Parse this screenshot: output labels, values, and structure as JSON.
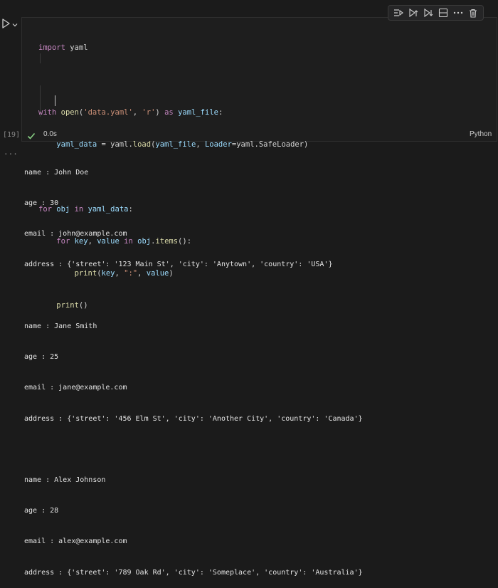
{
  "toolbar": {
    "icons": [
      "run-by-line-icon",
      "execute-above-icon",
      "execute-below-icon",
      "split-cell-icon",
      "more-icon",
      "delete-icon"
    ]
  },
  "cell": {
    "execution_count": "[19]",
    "duration": "0.0s",
    "language": "Python",
    "status": "success",
    "code": {
      "l1": {
        "kw": "import",
        "mod": " yaml"
      },
      "l3": {
        "kw": "with",
        "a": " ",
        "fn": "open",
        "b": "(",
        "s1": "'data.yaml'",
        "c": ", ",
        "s2": "'r'",
        "d": ") ",
        "as": "as",
        "e": " ",
        "v": "yaml_file",
        "f": ":"
      },
      "l4": {
        "indent": "    ",
        "v1": "yaml_data",
        "a": " = yaml.",
        "fn": "load",
        "b": "(",
        "v2": "yaml_file",
        "c": ", ",
        "v3": "Loader",
        "d": "=yaml.SafeLoader)"
      },
      "l6": {
        "kw": "for",
        "a": " ",
        "v1": "obj",
        "b": " ",
        "in": "in",
        "c": " ",
        "v2": "yaml_data",
        "d": ":"
      },
      "l7": {
        "indent": "    ",
        "kw": "for",
        "a": " ",
        "v1": "key",
        "b": ", ",
        "v2": "value",
        "c": " ",
        "in": "in",
        "d": " ",
        "v3": "obj",
        "e": ".",
        "fn": "items",
        "f": "():"
      },
      "l8": {
        "indent": "        ",
        "fn": "print",
        "a": "(",
        "v1": "key",
        "b": ", ",
        "s": "\":\"",
        "c": ", ",
        "v2": "value",
        "d": ")"
      },
      "l9": {
        "indent": "    ",
        "fn": "print",
        "a": "()"
      }
    }
  },
  "output": {
    "marker": "...",
    "lines": [
      "name : John Doe",
      "age : 30",
      "email : john@example.com",
      "address : {'street': '123 Main St', 'city': 'Anytown', 'country': 'USA'}",
      "",
      "name : Jane Smith",
      "age : 25",
      "email : jane@example.com",
      "address : {'street': '456 Elm St', 'city': 'Another City', 'country': 'Canada'}",
      "",
      "name : Alex Johnson",
      "age : 28",
      "email : alex@example.com",
      "address : {'street': '789 Oak Rd', 'city': 'Someplace', 'country': 'Australia'}"
    ]
  },
  "colors": {
    "background": "#1b1b1b",
    "keyword": "#569cd6",
    "control": "#c586c0",
    "function": "#dcdcaa",
    "string": "#ce9178",
    "variable": "#9cdcfe",
    "success": "#89d185"
  }
}
